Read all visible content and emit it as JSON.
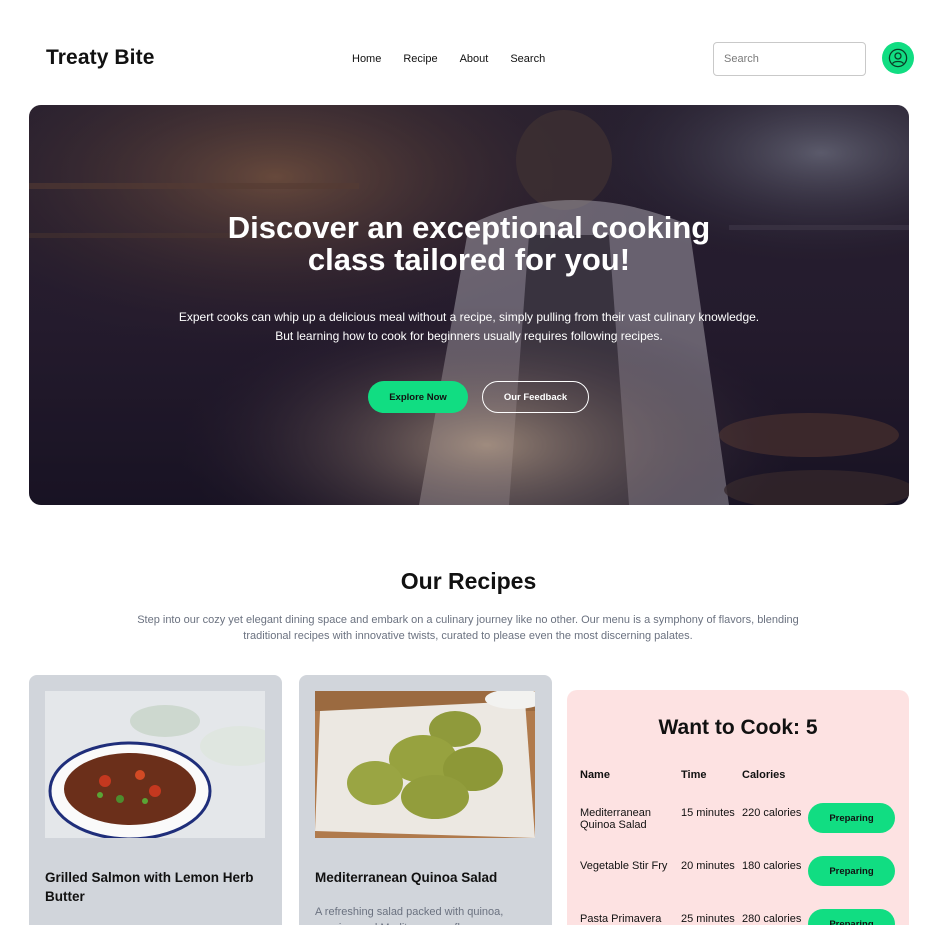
{
  "header": {
    "brand": "Treaty Bite",
    "nav": [
      "Home",
      "Recipe",
      "About",
      "Search"
    ],
    "search_placeholder": "Search"
  },
  "hero": {
    "title_line1": "Discover an exceptional cooking",
    "title_line2": "class tailored for you!",
    "sub_line1": "Expert cooks can whip up a delicious meal without a recipe, simply pulling from their vast culinary knowledge.",
    "sub_line2": "But learning how to cook for beginners usually requires following recipes.",
    "primary_button": "Explore Now",
    "secondary_button": "Our Feedback"
  },
  "recipes": {
    "title": "Our Recipes",
    "description": "Step into our cozy yet elegant dining space and embark on a culinary journey like no other. Our menu is a symphony of flavors, blending traditional recipes with innovative twists, curated to please even the most discerning palates.",
    "cards": [
      {
        "title": "Grilled Salmon with Lemon Herb Butter",
        "description": ""
      },
      {
        "title": "Mediterranean Quinoa Salad",
        "description": "A refreshing salad packed with quinoa, veggies, and Mediterranean flavors."
      }
    ]
  },
  "cook": {
    "title": "Want to Cook: 5",
    "headers": {
      "name": "Name",
      "time": "Time",
      "calories": "Calories"
    },
    "rows": [
      {
        "name": "Mediterranean Quinoa Salad",
        "time": "15 minutes",
        "calories": "220 calories",
        "action": "Preparing"
      },
      {
        "name": "Vegetable Stir Fry",
        "time": "20 minutes",
        "calories": "180 calories",
        "action": "Preparing"
      },
      {
        "name": "Pasta Primavera",
        "time": "25 minutes",
        "calories": "280 calories",
        "action": "Preparing"
      }
    ]
  },
  "colors": {
    "accent": "#11dd82",
    "card_bg": "#d1d5db",
    "panel_bg": "#fde2e2",
    "muted_text": "#6b7280"
  },
  "icons": {
    "avatar": "user-circle-icon"
  }
}
